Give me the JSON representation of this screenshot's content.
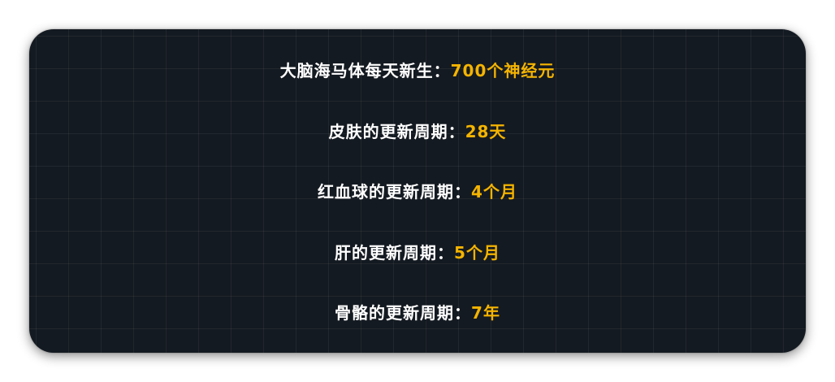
{
  "lines": [
    {
      "label": "大脑海马体每天新生：",
      "value": "700个神经元"
    },
    {
      "label": "皮肤的更新周期：",
      "value": "28天"
    },
    {
      "label": "红血球的更新周期：",
      "value": "4个月"
    },
    {
      "label": "肝的更新周期：",
      "value": "5个月"
    },
    {
      "label": "骨骼的更新周期：",
      "value": "7年"
    }
  ],
  "colors": {
    "background": "#141a21",
    "label": "#ffffff",
    "value": "#f5b400"
  }
}
